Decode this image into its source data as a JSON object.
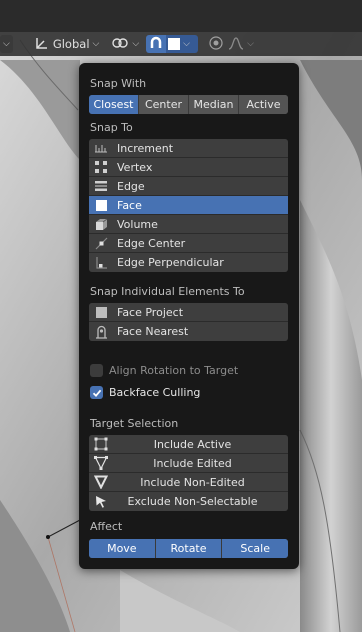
{
  "header": {
    "orientation_label": "Global",
    "icons": [
      "transform-orientation-icon",
      "pivot-point-icon",
      "snap-magnet-icon",
      "snap-target-face-icon",
      "proportional-editing-icon",
      "falloff-curve-icon"
    ]
  },
  "popup": {
    "snap_with": {
      "title": "Snap With",
      "options": [
        "Closest",
        "Center",
        "Median",
        "Active"
      ],
      "selected": "Closest"
    },
    "snap_to": {
      "title": "Snap To",
      "items": [
        {
          "label": "Increment",
          "icon": "increment-icon"
        },
        {
          "label": "Vertex",
          "icon": "vertex-icon"
        },
        {
          "label": "Edge",
          "icon": "edge-icon"
        },
        {
          "label": "Face",
          "icon": "face-icon"
        },
        {
          "label": "Volume",
          "icon": "volume-icon"
        },
        {
          "label": "Edge Center",
          "icon": "edge-center-icon"
        },
        {
          "label": "Edge Perpendicular",
          "icon": "edge-perpendicular-icon"
        }
      ],
      "selected": "Face"
    },
    "individual": {
      "title": "Snap Individual Elements To",
      "items": [
        {
          "label": "Face Project",
          "icon": "face-project-icon"
        },
        {
          "label": "Face Nearest",
          "icon": "face-nearest-icon"
        }
      ]
    },
    "align_rotation": {
      "label": "Align Rotation to Target",
      "checked": false
    },
    "backface_culling": {
      "label": "Backface Culling",
      "checked": true
    },
    "target_selection": {
      "title": "Target Selection",
      "items": [
        {
          "label": "Include Active",
          "icon": "include-active-icon"
        },
        {
          "label": "Include Edited",
          "icon": "include-edited-icon"
        },
        {
          "label": "Include Non-Edited",
          "icon": "include-non-edited-icon"
        },
        {
          "label": "Exclude Non-Selectable",
          "icon": "exclude-non-selectable-icon"
        }
      ]
    },
    "affect": {
      "title": "Affect",
      "options": [
        "Move",
        "Rotate",
        "Scale"
      ],
      "selected": [
        "Move",
        "Rotate",
        "Scale"
      ]
    }
  },
  "colors": {
    "accent": "#4772b3",
    "popup_bg": "#181818",
    "button_bg": "#545454",
    "list_bg": "#3e3e3e"
  }
}
